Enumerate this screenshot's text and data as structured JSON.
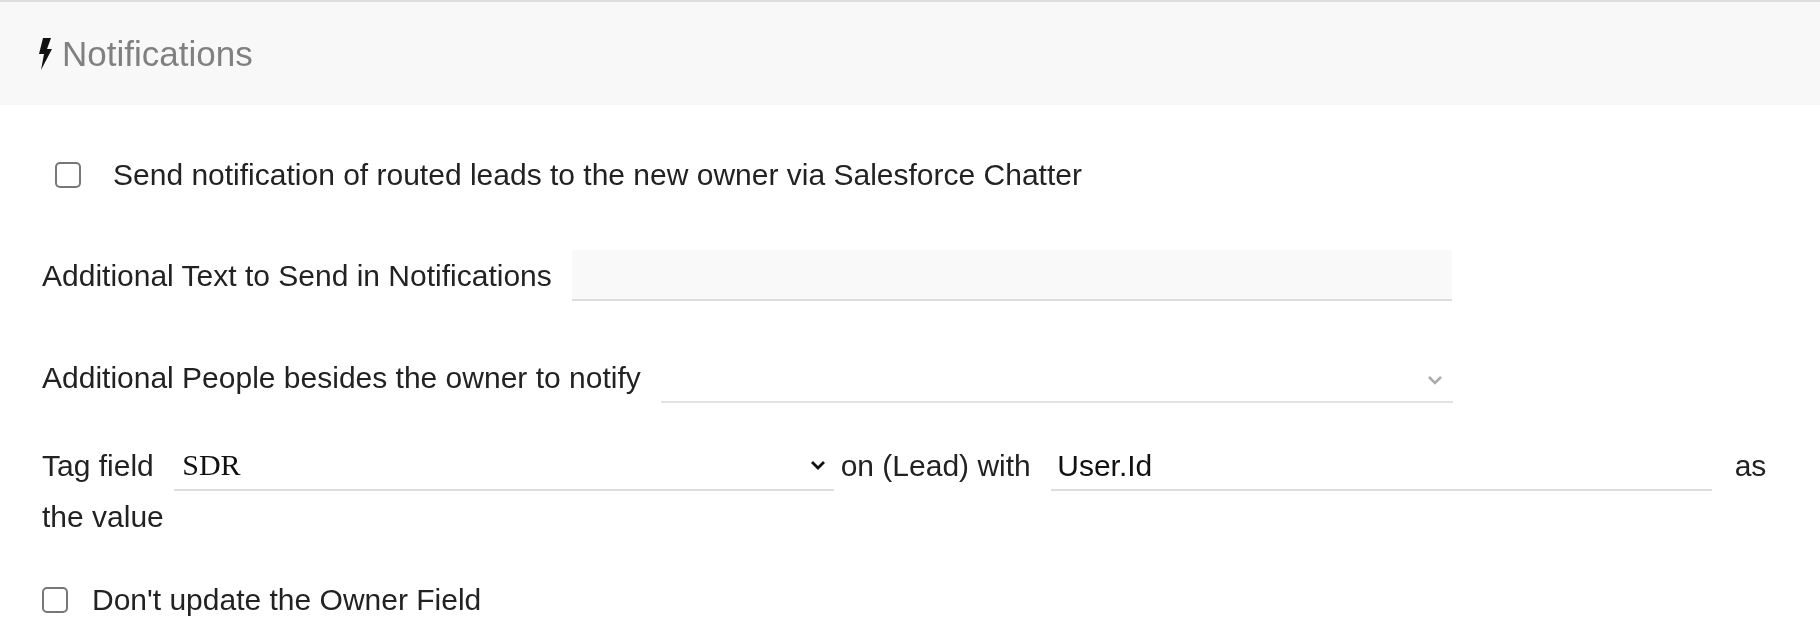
{
  "header": {
    "title": "Notifications"
  },
  "checkboxes": [
    {
      "label": "Send notification of routed leads to the new owner via Salesforce Chatter",
      "checked": false
    }
  ],
  "additional_text": {
    "label": "Additional Text to Send in Notifications"
  },
  "additional_people": {
    "label": "Additional People besides the owner to notify"
  },
  "tag_row": {
    "label": "Tag field",
    "field_value": "SDR",
    "connector": "on (Lead) with",
    "with_value": "User.Id",
    "suffix": "as",
    "suffix_wrapped": "the value"
  },
  "owner_option": {
    "label": "Don't update the Owner Field",
    "checked": false
  }
}
